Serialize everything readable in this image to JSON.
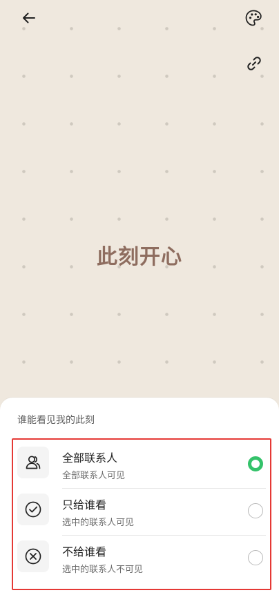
{
  "mood": {
    "text": "此刻开心"
  },
  "colors": {
    "background": "#efe8de",
    "dot": "#cfc9bf",
    "mood_text": "#8e6d5f",
    "accent_green": "#34c26a",
    "highlight_border": "#e53935"
  },
  "sheet": {
    "title": "谁能看见我的此刻",
    "options": [
      {
        "title": "全部联系人",
        "subtitle": "全部联系人可见",
        "icon": "contacts-icon",
        "selected": true
      },
      {
        "title": "只给谁看",
        "subtitle": "选中的联系人可见",
        "icon": "check-circle-icon",
        "selected": false
      },
      {
        "title": "不给谁看",
        "subtitle": "选中的联系人不可见",
        "icon": "x-circle-icon",
        "selected": false
      }
    ]
  },
  "icons": {
    "back": "back-arrow-icon",
    "palette": "palette-icon",
    "link": "link-icon"
  }
}
